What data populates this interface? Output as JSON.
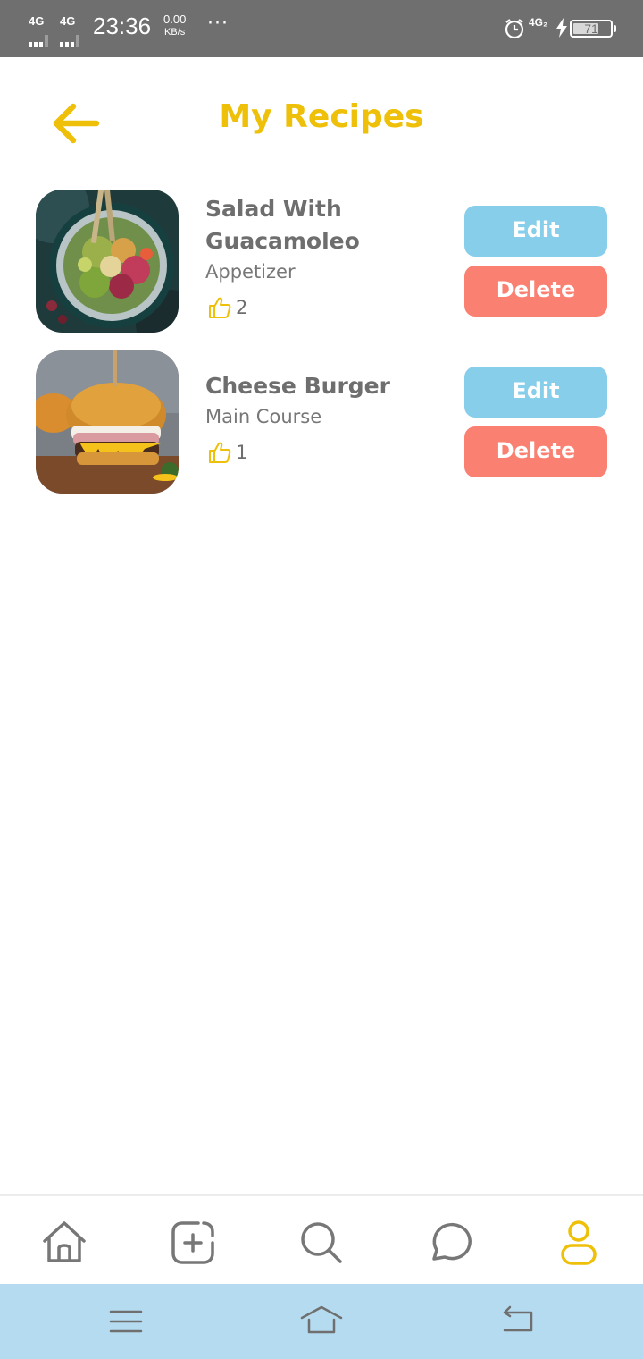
{
  "status_bar": {
    "network_1": "4G",
    "network_2": "4G",
    "time": "23:36",
    "speed_value": "0.00",
    "speed_unit": "KB/s",
    "more": "···",
    "network_3": "4G₂",
    "battery_level": "71",
    "battery_fraction": 0.71,
    "icons": [
      "signal-icon",
      "signal-icon",
      "alarm-icon",
      "charging-icon",
      "battery-icon"
    ]
  },
  "header": {
    "title": "My Recipes",
    "back_icon": "arrow-left-icon"
  },
  "recipes": [
    {
      "name": "Salad With Guacamoleo",
      "category": "Appetizer",
      "likes": "2",
      "edit_label": "Edit",
      "delete_label": "Delete"
    },
    {
      "name": "Cheese Burger",
      "category": "Main Course",
      "likes": "1",
      "edit_label": "Edit",
      "delete_label": "Delete"
    }
  ],
  "tab_bar": {
    "items": [
      "home-icon",
      "add-icon",
      "search-icon",
      "chat-icon",
      "profile-icon"
    ],
    "active": "profile-icon"
  },
  "system_nav": {
    "items": [
      "menu-icon",
      "home-icon",
      "back-icon"
    ]
  },
  "colors": {
    "accent": "#eec009",
    "edit": "#87ceeb",
    "delete": "#fa8072",
    "status_bar": "#6f6f6f",
    "system_nav": "#b5dbf1",
    "text": "#6e6e6e"
  }
}
